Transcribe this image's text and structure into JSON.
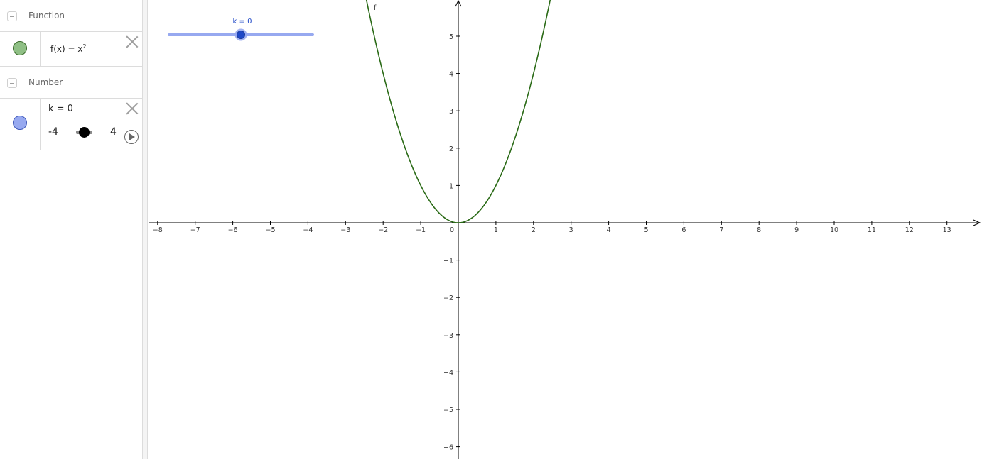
{
  "algebra": {
    "function_group": {
      "label": "Function",
      "item": {
        "color": "#8fbf85",
        "name": "f(x)",
        "equals": " = ",
        "base": "x",
        "exponent": "2"
      }
    },
    "number_group": {
      "label": "Number",
      "item": {
        "color": "#97a9f0",
        "definition": "k = 0",
        "min_label": "-4",
        "max_label": "4",
        "value_fraction": 0.5
      }
    }
  },
  "graphics": {
    "slider": {
      "label": "k = 0",
      "min": -4,
      "max": 4,
      "value": 0,
      "track_color": "#97a9f0",
      "point_color": "#1f48c7",
      "label_color": "#1f48c7"
    },
    "curve_label": "f",
    "curve_color": "#2a6a16",
    "x_ticks": [
      "−8",
      "−7",
      "−6",
      "−5",
      "−4",
      "−3",
      "−2",
      "−1",
      "0",
      "1",
      "2",
      "3",
      "4",
      "5",
      "6",
      "7",
      "8",
      "9",
      "10",
      "11",
      "12",
      "13"
    ],
    "y_ticks_pos": [
      "1",
      "2",
      "3",
      "4",
      "5"
    ],
    "y_ticks_neg": [
      "−1",
      "−2",
      "−3",
      "−4",
      "−5",
      "−6"
    ],
    "function": "x^2"
  }
}
